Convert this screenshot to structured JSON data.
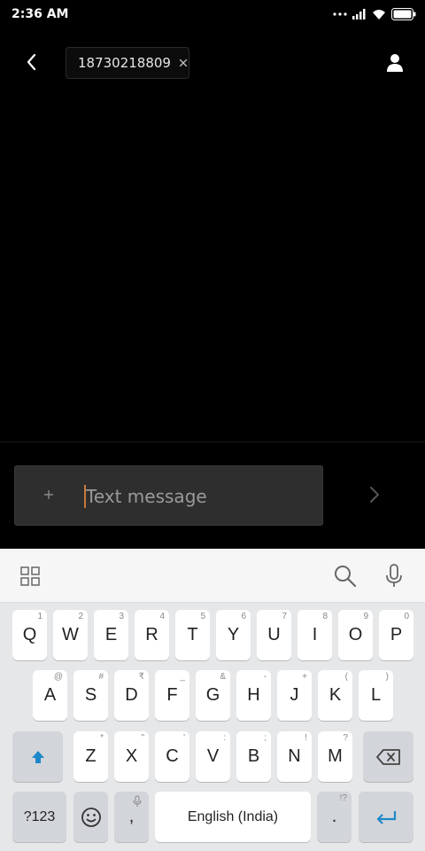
{
  "status_bar": {
    "time": "2:36 AM",
    "icons": [
      "more-dots-icon",
      "signal-icon",
      "wifi-icon",
      "battery-icon"
    ]
  },
  "header": {
    "recipient": "18730218809",
    "back_icon": "chevron-left-icon",
    "remove_icon": "close-icon",
    "contact_icon": "person-icon"
  },
  "compose": {
    "placeholder": "Text message",
    "add_icon": "plus-icon",
    "send_icon": "chevron-right-icon"
  },
  "keyboard": {
    "toolbar": {
      "apps_icon": "grid-icon",
      "search_icon": "search-icon",
      "mic_icon": "mic-icon"
    },
    "rows": [
      [
        {
          "k": "Q",
          "s": "1"
        },
        {
          "k": "W",
          "s": "2"
        },
        {
          "k": "E",
          "s": "3"
        },
        {
          "k": "R",
          "s": "4"
        },
        {
          "k": "T",
          "s": "5"
        },
        {
          "k": "Y",
          "s": "6"
        },
        {
          "k": "U",
          "s": "7"
        },
        {
          "k": "I",
          "s": "8"
        },
        {
          "k": "O",
          "s": "9"
        },
        {
          "k": "P",
          "s": "0"
        }
      ],
      [
        {
          "k": "A",
          "s": "@"
        },
        {
          "k": "S",
          "s": "#"
        },
        {
          "k": "D",
          "s": "₹"
        },
        {
          "k": "F",
          "s": "_"
        },
        {
          "k": "G",
          "s": "&"
        },
        {
          "k": "H",
          "s": "-"
        },
        {
          "k": "J",
          "s": "+"
        },
        {
          "k": "K",
          "s": "("
        },
        {
          "k": "L",
          "s": ")"
        }
      ],
      [
        {
          "k": "Z",
          "s": "*"
        },
        {
          "k": "X",
          "s": "\""
        },
        {
          "k": "C",
          "s": "'"
        },
        {
          "k": "V",
          "s": ":"
        },
        {
          "k": "B",
          "s": ";"
        },
        {
          "k": "N",
          "s": "!"
        },
        {
          "k": "M",
          "s": "?"
        }
      ]
    ],
    "symbols_label": "?123",
    "comma_label": ",",
    "space_label": "English (India)",
    "period_label": ".",
    "period_sup": "!?",
    "shift_icon": "shift-arrow-icon",
    "backspace_icon": "backspace-icon",
    "emoji_icon": "emoji-icon",
    "enter_icon": "enter-icon"
  }
}
